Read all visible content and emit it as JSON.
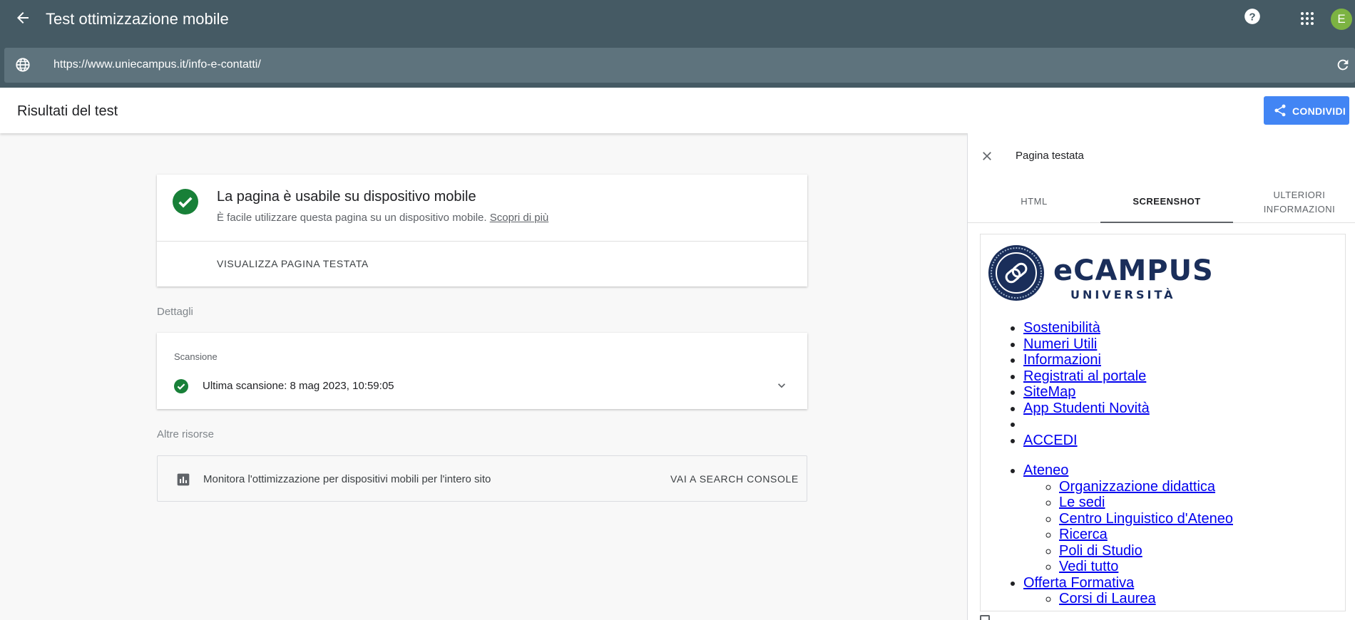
{
  "app": {
    "title": "Test ottimizzazione mobile",
    "avatar_letter": "E",
    "url": "https://www.uniecampus.it/info-e-contatti/"
  },
  "results": {
    "title": "Risultati del test",
    "share_label": "CONDIVIDI"
  },
  "verdict": {
    "heading": "La pagina è usabile su dispositivo mobile",
    "subtext": "È facile utilizzare questa pagina su un dispositivo mobile.",
    "learn_more": "Scopri di più",
    "view_page": "VISUALIZZA PAGINA TESTATA"
  },
  "details": {
    "label": "Dettagli",
    "scan_title": "Scansione",
    "scan_text": "Ultima scansione: 8 mag 2023, 10:59:05"
  },
  "resources": {
    "label": "Altre risorse",
    "text": "Monitora l'ottimizzazione per dispositivi mobili per l'intero sito",
    "link": "VAI A SEARCH CONSOLE"
  },
  "panel": {
    "title": "Pagina testata",
    "tabs": {
      "html": "HTML",
      "screenshot": "SCREENSHOT",
      "more_line1": "ULTERIORI",
      "more_line2": "INFORMAZIONI"
    },
    "active_tab": "SCREENSHOT"
  },
  "screenshot": {
    "logo_word": "eCAMPUS",
    "logo_sub": "UNIVERSITÀ",
    "top_links": [
      "Sostenibilità",
      "Numeri Utili",
      "Informazioni",
      "Registrati al portale",
      "SiteMap",
      "App Studenti Novità",
      "",
      "ACCEDI"
    ],
    "ateneo": "Ateneo",
    "ateneo_links": [
      "Organizzazione didattica",
      "Le sedi",
      "Centro Linguistico d'Ateneo",
      "Ricerca",
      "Poli di Studio",
      "Vedi tutto"
    ],
    "offerta": "Offerta Formativa",
    "offerta_links": [
      "Corsi di Laurea"
    ]
  },
  "colors": {
    "appbar": "#455a64",
    "urlbar": "#5e737d",
    "accent": "#4285f4",
    "success": "#188038",
    "link": "#0000ee"
  }
}
